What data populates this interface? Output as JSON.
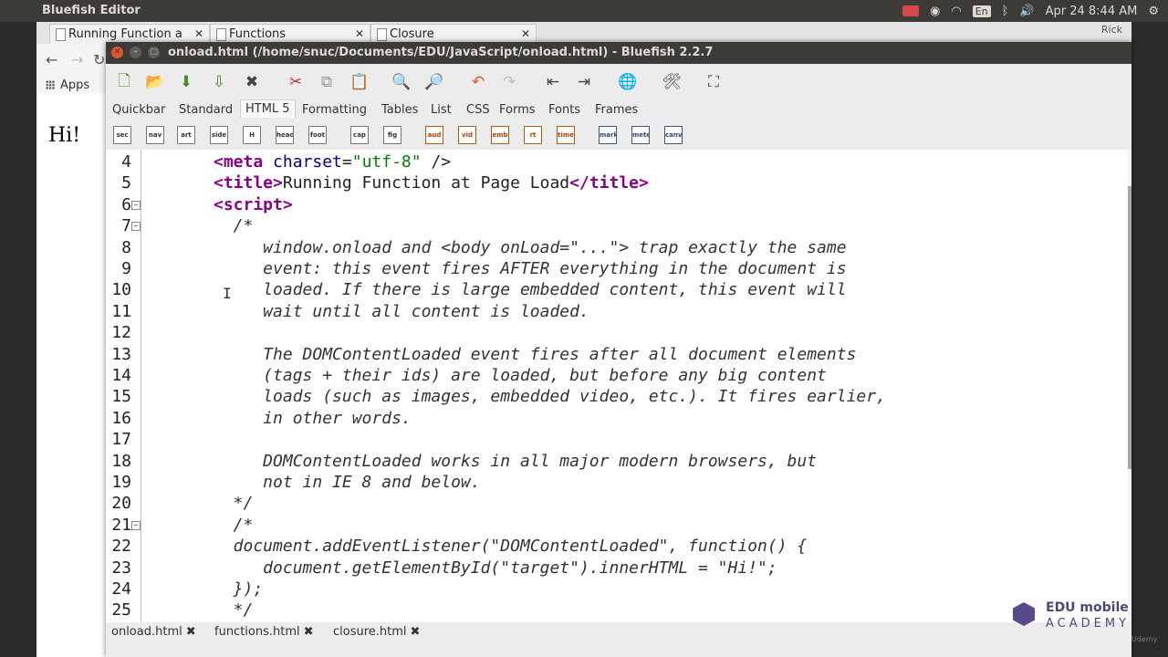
{
  "system_bar": {
    "app_name": "Bluefish Editor",
    "keyboard": "En",
    "datetime": "Apr 24  8:44 AM"
  },
  "browser": {
    "tabs": [
      {
        "label": "Running Function a"
      },
      {
        "label": "Functions"
      },
      {
        "label": "Closure"
      }
    ],
    "apps_label": "Apps",
    "user": "Rick",
    "content_text": "Hi!"
  },
  "editor": {
    "title": "onload.html (/home/snuc/Documents/EDU/JavaScript/onload.html) - Bluefish 2.2.7",
    "toolbar_tabs": [
      {
        "label": "Quickbar"
      },
      {
        "label": "Standard"
      },
      {
        "label": "HTML 5",
        "active": true
      },
      {
        "label": "Formatting"
      },
      {
        "label": "Tables"
      },
      {
        "label": "List"
      },
      {
        "label": "CSS"
      },
      {
        "label": "Forms"
      },
      {
        "label": "Fonts"
      },
      {
        "label": "Frames"
      }
    ],
    "html5_buttons": [
      "sec",
      "nav",
      "art",
      "side",
      "H",
      "head",
      "foot",
      "cap",
      "fig",
      "aud",
      "vid",
      "emb",
      "rt",
      "time",
      "mark",
      "meter",
      "canv"
    ],
    "code_lines": [
      {
        "n": "4",
        "segs": [
          [
            "tag",
            "<meta "
          ],
          [
            "attr",
            "charset"
          ],
          [
            "plain",
            "="
          ],
          [
            "str",
            "\"utf-8\""
          ],
          [
            "plain",
            " />"
          ]
        ]
      },
      {
        "n": "5",
        "segs": [
          [
            "tag",
            "<title>"
          ],
          [
            "plain",
            "Running Function at Page Load"
          ],
          [
            "tag",
            "</title>"
          ]
        ]
      },
      {
        "n": "6",
        "segs": [
          [
            "tag",
            "<script>"
          ]
        ]
      },
      {
        "n": "7",
        "segs": [
          [
            "cmt",
            "  /*"
          ]
        ]
      },
      {
        "n": "8",
        "segs": [
          [
            "cmt",
            "     window.onload and <body onLoad=\"...\"> trap exactly the same"
          ]
        ]
      },
      {
        "n": "9",
        "segs": [
          [
            "cmt",
            "     event: this event fires AFTER everything in the document is"
          ]
        ]
      },
      {
        "n": "10",
        "segs": [
          [
            "cmt",
            "     loaded. If there is large embedded content, this event will"
          ]
        ]
      },
      {
        "n": "11",
        "segs": [
          [
            "cmt",
            "     wait until all content is loaded."
          ]
        ]
      },
      {
        "n": "12",
        "segs": [
          [
            "cmt",
            ""
          ]
        ]
      },
      {
        "n": "13",
        "segs": [
          [
            "cmt",
            "     The DOMContentLoaded event fires after all document elements"
          ]
        ]
      },
      {
        "n": "14",
        "segs": [
          [
            "cmt",
            "     (tags + their ids) are loaded, but before any big content"
          ]
        ]
      },
      {
        "n": "15",
        "segs": [
          [
            "cmt",
            "     loads (such as images, embedded video, etc.). It fires earlier,"
          ]
        ]
      },
      {
        "n": "16",
        "segs": [
          [
            "cmt",
            "     in other words."
          ]
        ]
      },
      {
        "n": "17",
        "segs": [
          [
            "cmt",
            ""
          ]
        ]
      },
      {
        "n": "18",
        "segs": [
          [
            "cmt",
            "     DOMContentLoaded works in all major modern browsers, but"
          ]
        ]
      },
      {
        "n": "19",
        "segs": [
          [
            "cmt",
            "     not in IE 8 and below."
          ]
        ]
      },
      {
        "n": "20",
        "segs": [
          [
            "cmt",
            "  */"
          ]
        ]
      },
      {
        "n": "21",
        "segs": [
          [
            "cmt",
            "  /*"
          ]
        ]
      },
      {
        "n": "22",
        "segs": [
          [
            "cmt",
            "  document.addEventListener(\"DOMContentLoaded\", function() {"
          ]
        ]
      },
      {
        "n": "23",
        "segs": [
          [
            "cmt",
            "     document.getElementById(\"target\").innerHTML = \"Hi!\";"
          ]
        ]
      },
      {
        "n": "24",
        "segs": [
          [
            "cmt",
            "  });"
          ]
        ]
      },
      {
        "n": "25",
        "segs": [
          [
            "cmt",
            "  */"
          ]
        ]
      }
    ],
    "file_tabs": [
      {
        "label": "onload.html"
      },
      {
        "label": "functions.html"
      },
      {
        "label": "closure.html"
      }
    ]
  },
  "watermark": {
    "line1": "EDU mobile",
    "line2": "ACADEMY",
    "line3": "Udemy"
  }
}
